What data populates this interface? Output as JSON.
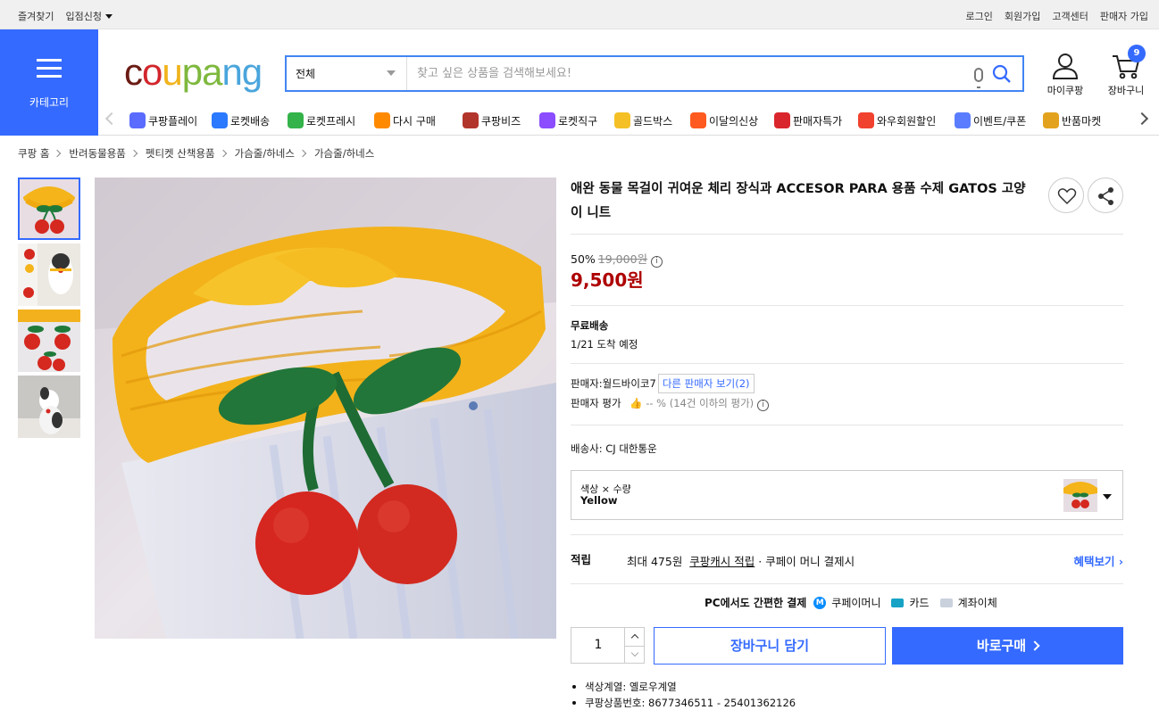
{
  "util": {
    "left": [
      "즐겨찾기",
      "입점신청"
    ],
    "right": [
      "로그인",
      "회원가입",
      "고객센터",
      "판매자 가입"
    ]
  },
  "header": {
    "category_label": "카테고리",
    "logo": "coupang",
    "search_category": "전체",
    "search_placeholder": "찾고 싶은 상품을 검색해보세요!",
    "mycoupang": "마이쿠팡",
    "cart": "장바구니",
    "cart_count": "9"
  },
  "menu": [
    {
      "label": "쿠팡플레이",
      "icon": "play-icon",
      "color": "#5a6cff"
    },
    {
      "label": "로켓배송",
      "icon": "rocket-icon",
      "color": "#2b79ff"
    },
    {
      "label": "로켓프레시",
      "icon": "rocket-fresh-icon",
      "color": "#33b34a"
    },
    {
      "label": "다시 구매",
      "icon": "basket-icon",
      "color": "#ff8a00"
    },
    {
      "label": "쿠팡비즈",
      "icon": "biz-icon",
      "color": "#b2352b"
    },
    {
      "label": "로켓직구",
      "icon": "globe-icon",
      "color": "#8b4dff"
    },
    {
      "label": "골드박스",
      "icon": "goldbox-icon",
      "color": "#f4c026"
    },
    {
      "label": "이달의신상",
      "icon": "new-icon",
      "color": "#ff5a1f"
    },
    {
      "label": "판매자특가",
      "icon": "percent-icon",
      "color": "#d9262c"
    },
    {
      "label": "와우회원할인",
      "icon": "wow-icon",
      "color": "#f1412f"
    },
    {
      "label": "이벤트/쿠폰",
      "icon": "coupon-icon",
      "color": "#5a7dff"
    },
    {
      "label": "반품마켓",
      "icon": "market-icon",
      "color": "#e3a21e"
    }
  ],
  "breadcrumb": [
    "쿠팡 홈",
    "반려동물용품",
    "펫티켓 산책용품",
    "가슴줄/하네스",
    "가슴줄/하네스"
  ],
  "product": {
    "title": "애완 동물 목걸이 귀여운 체리 장식과 ACCESOR PARA 용품 수제 GATOS 고양이 니트",
    "discount": "50%",
    "original_price": "19,000원",
    "price": "9,500원",
    "shipping_label": "무료배송",
    "arrival": "1/21 도착 예정",
    "seller": "판매자:월드바이코7",
    "other_sellers": "다른 판매자 보기(2)",
    "seller_rating_label": "판매자 평가",
    "seller_rating": "-- % (14건 이하의 평가)",
    "courier": "배송사:  CJ 대한통운",
    "option_label": "색상 × 수량",
    "option_value": "Yellow",
    "reward_label": "적립",
    "reward_text_1": "최대 475원",
    "reward_text_2": "쿠팡캐시 적립",
    "reward_text_3": "· 쿠페이 머니 결제시",
    "reward_link": "혜택보기",
    "pay_label": "PC에서도 간편한 결제",
    "pay_1": "쿠페이머니",
    "pay_2": "카드",
    "pay_3": "계좌이체",
    "quantity": "1",
    "cart_button": "장바구니 담기",
    "buy_button": "바로구매",
    "details": [
      "색상계열: 옐로우계열",
      "쿠팡상품번호: 8677346511 - 25401362126"
    ]
  }
}
